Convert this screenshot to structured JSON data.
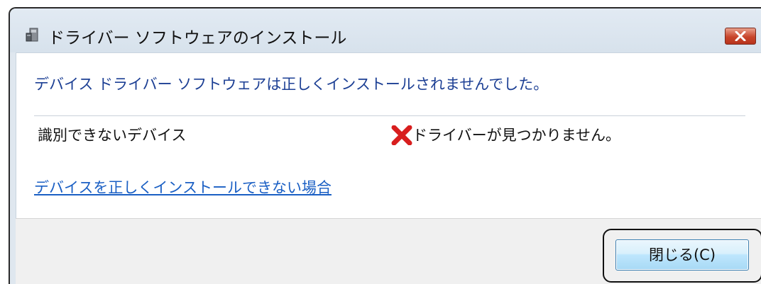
{
  "window": {
    "title": "ドライバー ソフトウェアのインストール",
    "title_icon": "device-install-icon",
    "close_icon": "close-icon",
    "close_button_color": "#c8452b"
  },
  "content": {
    "heading": "デバイス ドライバー ソフトウェアは正しくインストールされませんでした。",
    "heading_color": "#1c3f94",
    "device": {
      "name": "識別できないデバイス",
      "status_icon": "error-x-icon",
      "status_icon_color": "#d81e1e",
      "status": "ドライバーが見つかりません。"
    },
    "help_link": "デバイスを正しくインストールできない場合",
    "link_color": "#1a5fc4"
  },
  "footer": {
    "close_button": "閉じる(C)"
  }
}
